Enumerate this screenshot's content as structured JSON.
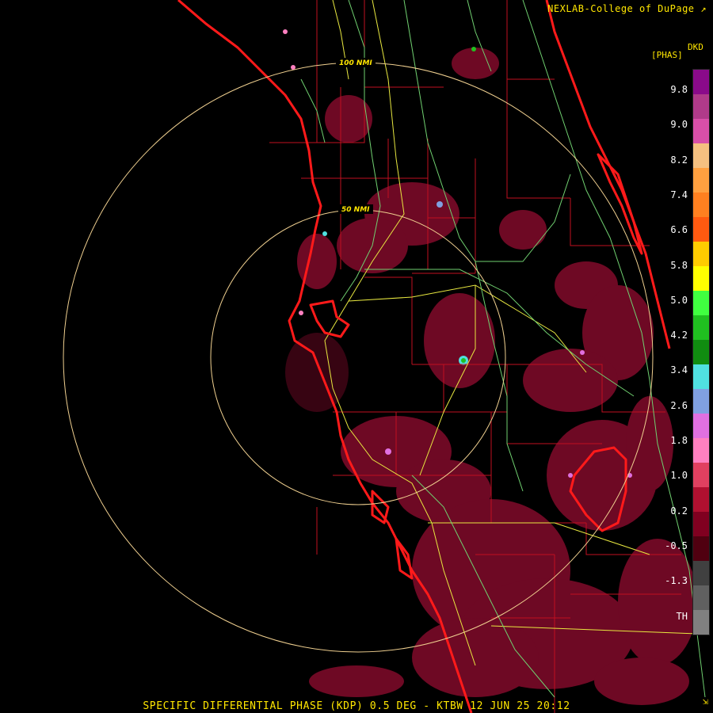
{
  "header": {
    "credit": "NEXLAB-College of DuPage",
    "credit_mark": "↗"
  },
  "legend": {
    "product_code": "DKD",
    "units": "[PHAS]",
    "labels": [
      "9.8",
      "9.0",
      "8.2",
      "7.4",
      "6.6",
      "5.8",
      "5.0",
      "4.2",
      "3.4",
      "2.6",
      "1.8",
      "1.0",
      "0.2",
      "-0.5",
      "-1.3",
      "TH"
    ],
    "colors": [
      "#8a0a8a",
      "#b03a8a",
      "#d84fa8",
      "#f5c080",
      "#ffa040",
      "#ff8020",
      "#ff5a10",
      "#ffcc00",
      "#ffff00",
      "#40ff40",
      "#20c020",
      "#108c10",
      "#50e0e0",
      "#80a0e0",
      "#e070e0",
      "#ff80c0",
      "#e04060",
      "#b01030",
      "#800020",
      "#500010",
      "#404040",
      "#606060",
      "#808080"
    ]
  },
  "rings": [
    {
      "label": "100 NMI"
    },
    {
      "label": "50 NMI"
    }
  ],
  "footer": {
    "caption": "SPECIFIC DIFFERENTIAL PHASE (KDP) 0.5 DEG - KTBW 12 JUN 25 20:12"
  },
  "colors": {
    "coastline": "#ff1a1a",
    "county": "#c01020",
    "road": "#e8e840",
    "highway": "#70d070",
    "ring": "#f0d090",
    "echo": "#7a0a28"
  }
}
